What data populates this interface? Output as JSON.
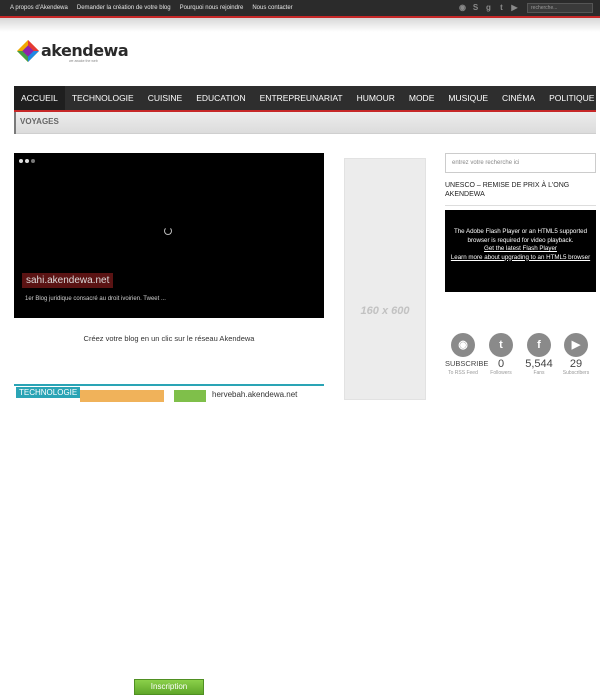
{
  "topbar": {
    "links": [
      "A propos d'Akendewa",
      "Demander la création de votre blog",
      "Pourquoi nous rejoindre",
      "Nous contacter"
    ],
    "social_icons": [
      "rss-icon",
      "skype-icon",
      "google-plus-icon",
      "twitter-icon",
      "youtube-icon"
    ],
    "search_placeholder": "recherche..."
  },
  "logo": {
    "name": "akendewa",
    "tagline": "we awake the web"
  },
  "nav": {
    "items": [
      "ACCUEIL",
      "TECHNOLOGIE",
      "CUISINE",
      "EDUCATION",
      "ENTREPREUNARIAT",
      "HUMOUR",
      "MODE",
      "MUSIQUE",
      "CINÉMA",
      "POLITIQUE"
    ],
    "sub_items": [
      "VOYAGES"
    ]
  },
  "slider": {
    "caption_title": "sahi.akendewa.net",
    "caption_text": "1er Blog juridique consacré au droit ivoirien.    Tweet ..."
  },
  "promo": {
    "text": "Créez votre blog en un clic sur le réseau Akendewa",
    "button": "Inscription"
  },
  "bottom": {
    "category": "TECHNOLOGIE",
    "site": "hervebah.akendewa.net"
  },
  "ad": {
    "label": "160 x 600"
  },
  "sidebar": {
    "search_placeholder": "entrez votre recherche ici",
    "widget_title": "UNESCO – REMISE DE PRIX À L'ONG AKENDEWA",
    "video_message": "The Adobe Flash Player or an HTML5 supported browser is required for video playback.",
    "video_link1": "Get the latest Flash Player",
    "video_link2": "Learn more about upgrading to an HTML5 browser",
    "stats": [
      {
        "icon": "rss-icon",
        "glyph": "◉",
        "count": "SUBSCRIBE",
        "label": "To RSS Feed"
      },
      {
        "icon": "twitter-icon",
        "glyph": "t",
        "count": "0",
        "label": "Followers"
      },
      {
        "icon": "facebook-icon",
        "glyph": "f",
        "count": "5,544",
        "label": "Fans"
      },
      {
        "icon": "youtube-icon",
        "glyph": "▶",
        "count": "29",
        "label": "Subscribers"
      }
    ]
  }
}
